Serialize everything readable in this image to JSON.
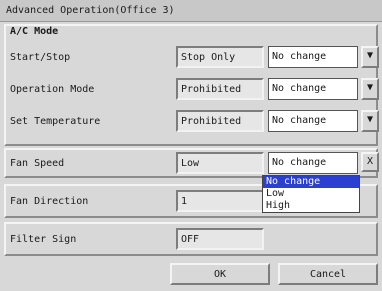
{
  "window": {
    "title": "Advanced Operation(Office 3)"
  },
  "ac_mode": {
    "group_title": "A/C Mode",
    "rows": [
      {
        "label": "Start/Stop",
        "value": "Stop Only",
        "select": "No change"
      },
      {
        "label": "Operation Mode",
        "value": "Prohibited",
        "select": "No change"
      },
      {
        "label": "Set Temperature",
        "value": "Prohibited",
        "select": "No change"
      }
    ]
  },
  "fan_speed": {
    "label": "Fan Speed",
    "value": "Low",
    "select": "No change",
    "close": "X"
  },
  "fan_speed_dropdown": {
    "options": [
      "No change",
      "Low",
      "High"
    ],
    "highlighted": "No change"
  },
  "fan_direction": {
    "label": "Fan Direction",
    "value": "1"
  },
  "filter_sign": {
    "label": "Filter Sign",
    "value": "OFF"
  },
  "buttons": {
    "ok": "OK",
    "cancel": "Cancel"
  },
  "icons": {
    "dropdown_arrow": "triangle-down"
  },
  "colors": {
    "highlight": "#2b3fd0",
    "background": "#d8d8d8"
  }
}
